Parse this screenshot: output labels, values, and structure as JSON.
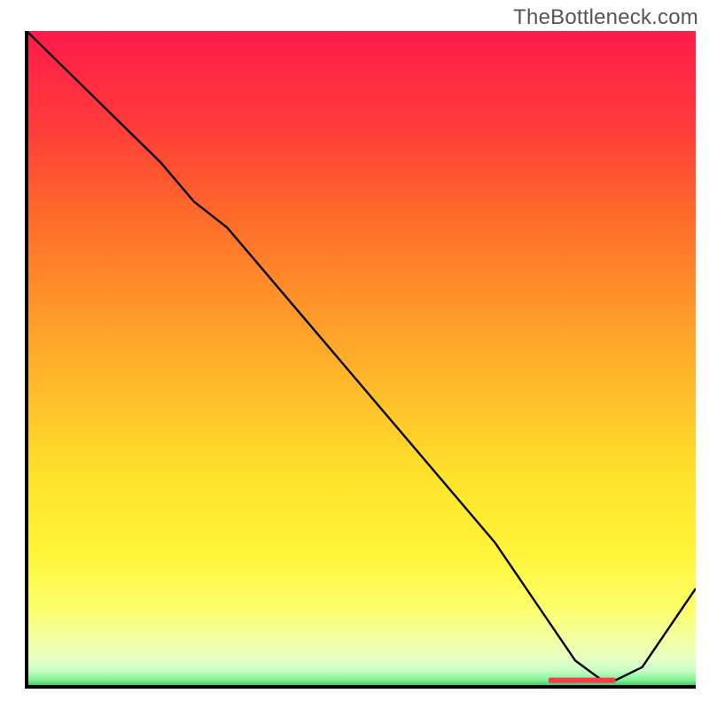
{
  "attribution": {
    "text": "TheBottleneck.com"
  },
  "chart_data": {
    "type": "line",
    "title": "",
    "xlabel": "",
    "ylabel": "",
    "xlim": [
      0,
      100
    ],
    "ylim": [
      0,
      100
    ],
    "x": [
      0,
      8,
      12,
      20,
      25,
      30,
      40,
      50,
      60,
      70,
      78,
      82,
      86,
      88,
      92,
      100
    ],
    "values": [
      100,
      92,
      88,
      80,
      74,
      70,
      58,
      46,
      34,
      22,
      10,
      4,
      1,
      1,
      3,
      15
    ],
    "marker_band": {
      "x_start": 78,
      "x_end": 88,
      "y": 1
    },
    "gradient_stops": [
      {
        "offset": 0.0,
        "color": "#ff1a4b"
      },
      {
        "offset": 0.14,
        "color": "#ff3a3a"
      },
      {
        "offset": 0.28,
        "color": "#ff6a2a"
      },
      {
        "offset": 0.42,
        "color": "#ff962a"
      },
      {
        "offset": 0.56,
        "color": "#ffc02a"
      },
      {
        "offset": 0.68,
        "color": "#ffe22a"
      },
      {
        "offset": 0.8,
        "color": "#fff53a"
      },
      {
        "offset": 0.88,
        "color": "#fcff6a"
      },
      {
        "offset": 0.92,
        "color": "#f5ff9a"
      },
      {
        "offset": 0.955,
        "color": "#e8ffc0"
      },
      {
        "offset": 0.975,
        "color": "#c8ffc8"
      },
      {
        "offset": 0.99,
        "color": "#80f090"
      },
      {
        "offset": 1.0,
        "color": "#20c060"
      }
    ],
    "axes_color": "#000000",
    "line_color": "#000000"
  }
}
